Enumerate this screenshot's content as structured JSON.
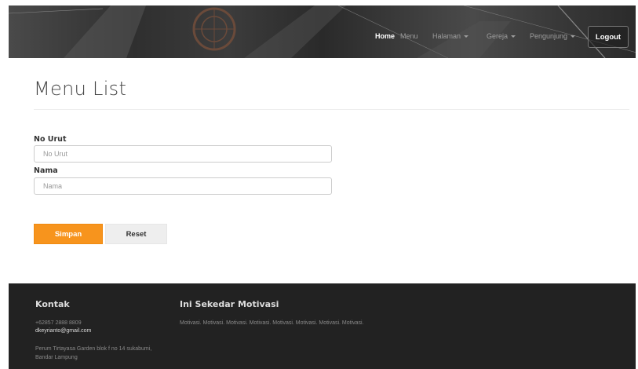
{
  "nav": {
    "home": "Home",
    "menu": "Menu",
    "halaman": "Halaman",
    "gereja": "Gereja",
    "pengunjung": "Pengunjung",
    "logout": "Logout"
  },
  "main": {
    "title": "Menu List",
    "no_urut": {
      "label": "No Urut",
      "placeholder": "No Urut",
      "value": ""
    },
    "nama": {
      "label": "Nama",
      "placeholder": "Nama",
      "value": ""
    },
    "save_label": "Simpan",
    "reset_label": "Reset"
  },
  "footer": {
    "contact_heading": "Kontak",
    "phone": "+62857 2888 8809",
    "email": "dkeyrianto@gmail.com",
    "address_line1": "Perum Tirtayasa Garden blok f no 14 sukabumi,",
    "address_line2": "Bandar Lampung",
    "motivation_heading": "Ini Sekedar Motivasi",
    "motivation_text": "Motivasi. Motivasi. Motivasi. Motivasi. Motivasi. Motivasi. Motivasi. Motivasi."
  },
  "colors": {
    "accent": "#f7941d",
    "footer_bg": "#222222",
    "header_bg": "#3a3a3a"
  }
}
